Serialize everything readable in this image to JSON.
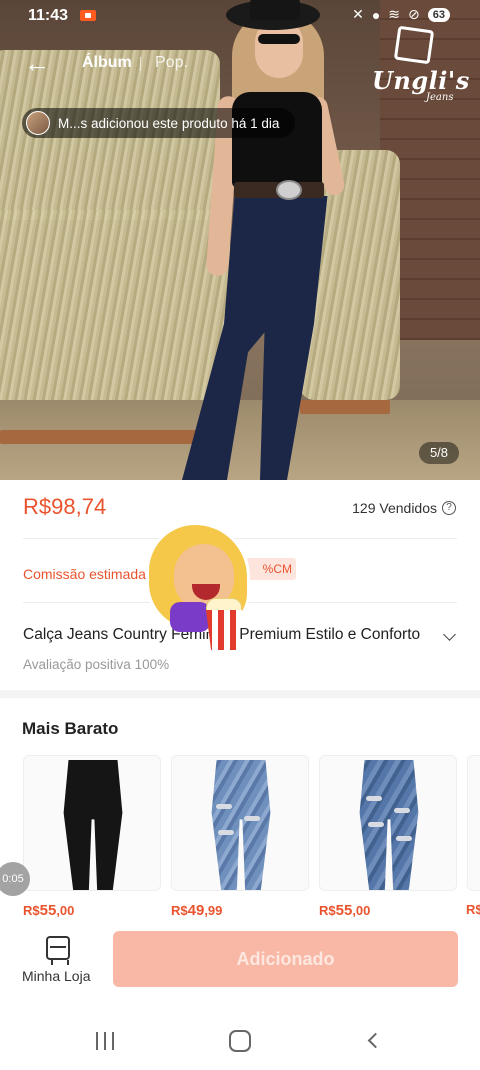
{
  "status_bar": {
    "time": "11:43",
    "battery": "63"
  },
  "header": {
    "tabs": [
      {
        "label": "Álbum",
        "active": true
      },
      {
        "label": "Pop.",
        "active": false
      }
    ],
    "brand": {
      "name": "Ungli's",
      "sub": "Jeans"
    }
  },
  "hero": {
    "added_notice": "M...s adicionou este produto há 1 dia",
    "page_counter": "5/8"
  },
  "product": {
    "price": "R$98,74",
    "sold": "129 Vendidos",
    "commission_label": "Comissão estimada",
    "commission_badge": "%CM",
    "title": "Calça Jeans Country Feminina Premium Estilo e Conforto",
    "rating": "Avaliação positiva 100%"
  },
  "cheaper": {
    "title": "Mais Barato",
    "items": [
      {
        "currency": "R$",
        "int": "55",
        "dec": ",00",
        "color": "black"
      },
      {
        "currency": "R$",
        "int": "49",
        "dec": ",99",
        "color": "lightblue"
      },
      {
        "currency": "R$",
        "int": "55",
        "dec": ",00",
        "color": "midblue"
      }
    ],
    "peek_price": "R$"
  },
  "timer": "0:05",
  "bottom_bar": {
    "store_label": "Minha Loja",
    "cta_label": "Adicionado"
  },
  "colors": {
    "accent": "#e9542f",
    "cta_disabled": "#f8b8a5",
    "badge_bg": "#fde5dd"
  }
}
